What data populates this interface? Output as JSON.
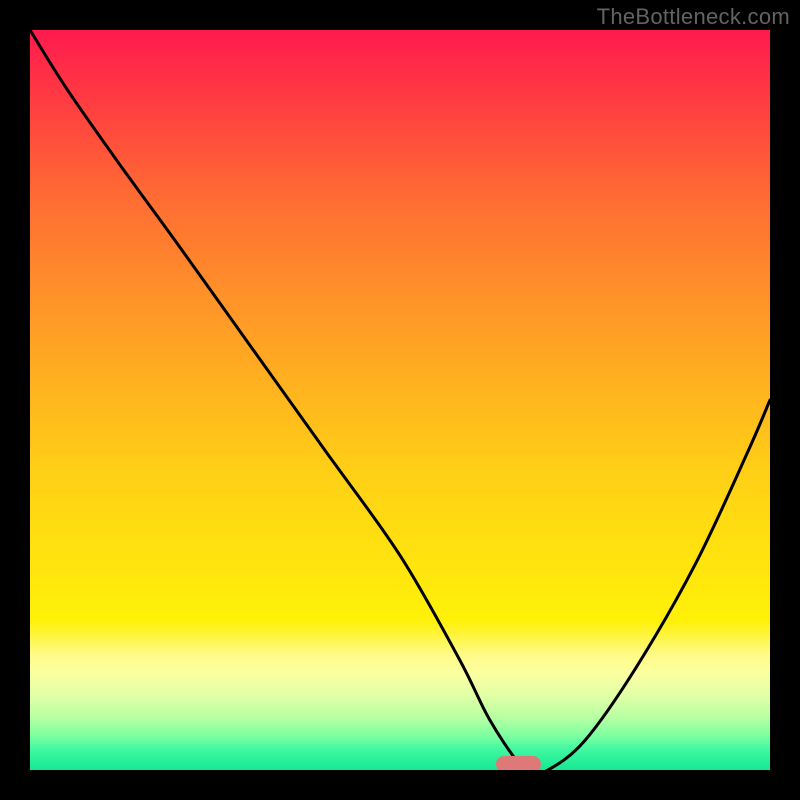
{
  "watermark": "TheBottleneck.com",
  "colors": {
    "black": "#000000",
    "curve": "#000000",
    "marker": "#dd7a77"
  },
  "chart_data": {
    "type": "line",
    "title": "",
    "xlabel": "",
    "ylabel": "",
    "x_range": [
      0,
      100
    ],
    "y_range": [
      0,
      100
    ],
    "gradient_stops": [
      {
        "pos": 0.0,
        "color": "#ff1a4e"
      },
      {
        "pos": 0.1,
        "color": "#ff3e41"
      },
      {
        "pos": 0.22,
        "color": "#ff6a34"
      },
      {
        "pos": 0.35,
        "color": "#ff8f2a"
      },
      {
        "pos": 0.48,
        "color": "#ffb21f"
      },
      {
        "pos": 0.6,
        "color": "#ffd016"
      },
      {
        "pos": 0.72,
        "color": "#ffe40e"
      },
      {
        "pos": 0.8,
        "color": "#fff108"
      },
      {
        "pos": 0.845,
        "color": "#fffb87"
      },
      {
        "pos": 0.87,
        "color": "#fcffa0"
      },
      {
        "pos": 0.9,
        "color": "#e2ffa6"
      },
      {
        "pos": 0.93,
        "color": "#b8ffa2"
      },
      {
        "pos": 0.955,
        "color": "#7dffa0"
      },
      {
        "pos": 0.975,
        "color": "#3df7a0"
      },
      {
        "pos": 1.0,
        "color": "#19e893"
      }
    ],
    "series": [
      {
        "name": "bottleneck-curve",
        "x": [
          0,
          5,
          12,
          20,
          30,
          40,
          50,
          58,
          62,
          66,
          68,
          70,
          75,
          82,
          90,
          97,
          100
        ],
        "y": [
          100,
          92,
          82,
          71,
          57,
          43,
          29,
          15,
          7,
          1,
          0,
          0,
          4,
          14,
          28,
          43,
          50
        ]
      }
    ],
    "marker": {
      "x_center": 66,
      "width_pct": 6,
      "y": 0.5
    }
  }
}
